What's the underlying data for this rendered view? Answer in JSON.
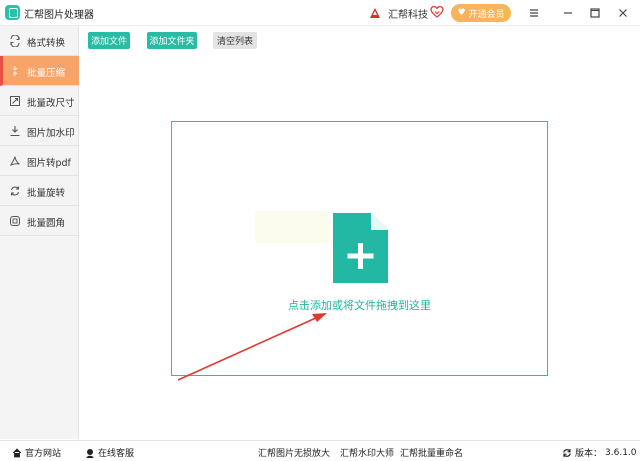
{
  "app": {
    "title": "汇帮图片处理器"
  },
  "header": {
    "brand": "汇帮科技",
    "vip_label": "开通会员"
  },
  "sidebar": {
    "items": [
      {
        "label": "格式转换",
        "icon": "format-convert-icon",
        "active": false
      },
      {
        "label": "批量压缩",
        "icon": "compress-icon",
        "active": true
      },
      {
        "label": "批量改尺寸",
        "icon": "resize-icon",
        "active": false
      },
      {
        "label": "图片加水印",
        "icon": "watermark-icon",
        "active": false
      },
      {
        "label": "图片转pdf",
        "icon": "pdf-icon",
        "active": false
      },
      {
        "label": "批量旋转",
        "icon": "rotate-icon",
        "active": false
      },
      {
        "label": "批量圆角",
        "icon": "round-corner-icon",
        "active": false
      }
    ]
  },
  "toolbar": {
    "add_file": "添加文件",
    "add_folder": "添加文件夹",
    "clear_list": "清空列表"
  },
  "dropzone": {
    "text": "点击添加或将文件拖拽到这里"
  },
  "footer": {
    "website": "官方网站",
    "support": "在线客服",
    "link1": "汇帮图片无损放大",
    "link2": "汇帮水印大师",
    "link3": "汇帮批量重命名",
    "version_label": "版本：",
    "version": "3.6.1.0"
  },
  "colors": {
    "accent": "#27bca3",
    "active_bg": "#f7a46a",
    "active_bar": "#e94f43",
    "vip": "#f9b35a",
    "arrow": "#e03a2e"
  }
}
